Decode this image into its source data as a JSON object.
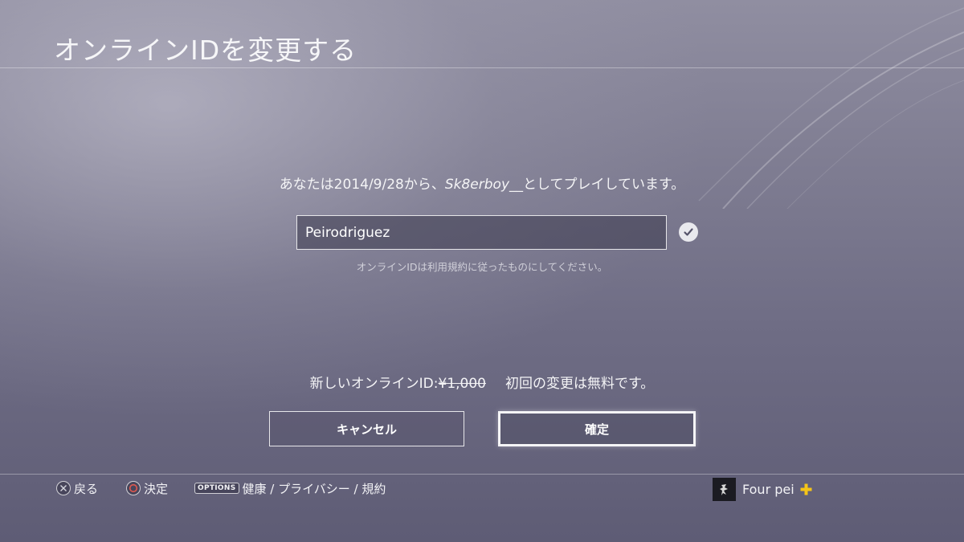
{
  "page": {
    "title": "オンラインIDを変更する"
  },
  "message": {
    "prefix": "あなたは2014/9/28から、",
    "current_id": "Sk8erboy__",
    "suffix": "としてプレイしています。"
  },
  "form": {
    "online_id_value": "Peirodriguez",
    "hint": "オンラインIDは利用規約に従ったものにしてください。",
    "valid_icon": "check-icon"
  },
  "price": {
    "label": "新しいオンラインID:",
    "old_price": "¥1,000",
    "note": "初回の変更は無料です。"
  },
  "buttons": {
    "cancel_label": "キャンセル",
    "confirm_label": "確定"
  },
  "footer": {
    "back_label": "戻る",
    "back_icon": "cross-button-icon",
    "decide_label": "決定",
    "decide_icon": "circle-button-icon",
    "options_glyph": "OPTIONS",
    "options_label": "健康 / プライバシー / 規約"
  },
  "user": {
    "name": "Four pei",
    "avatar_icon": "avatar-icon",
    "plus_icon": "playstation-plus-icon",
    "plus_color": "#f5c518"
  },
  "colors": {
    "background": "#7f7d92",
    "text": "#ffffff"
  }
}
